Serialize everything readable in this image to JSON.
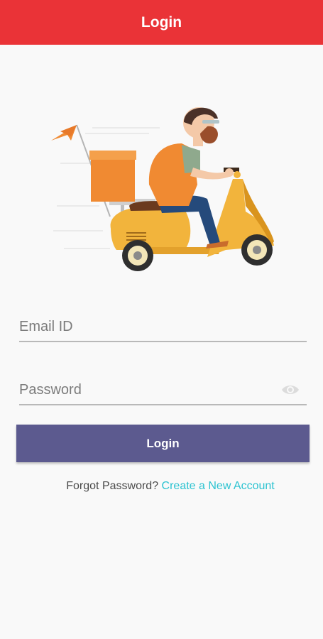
{
  "header": {
    "title": "Login"
  },
  "form": {
    "email_placeholder": "Email ID",
    "password_placeholder": "Password",
    "login_label": "Login"
  },
  "links": {
    "forgot_password": "Forgot Password?",
    "create_account": "Create a New Account"
  },
  "icons": {
    "password_toggle": "eye-icon",
    "illustration": "delivery-scooter-illustration"
  },
  "colors": {
    "appbar": "#ea3337",
    "button": "#5c5a8f",
    "link": "#2cc3d1",
    "accent_orange": "#f08a32"
  }
}
